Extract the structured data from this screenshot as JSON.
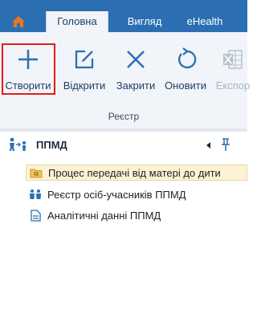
{
  "tabs": {
    "home_icon": "home-icon",
    "items": [
      {
        "label": "Головна",
        "active": true
      },
      {
        "label": "Вигляд",
        "active": false
      },
      {
        "label": "eHealth",
        "active": false
      }
    ]
  },
  "ribbon": {
    "buttons": [
      {
        "label": "Створити",
        "icon": "plus-icon"
      },
      {
        "label": "Відкрити",
        "icon": "edit-icon"
      },
      {
        "label": "Закрити",
        "icon": "close-icon"
      },
      {
        "label": "Оновити",
        "icon": "refresh-icon"
      },
      {
        "label": "Експор",
        "icon": "excel-icon",
        "disabled": true
      }
    ],
    "group_label": "Реєстр",
    "accent_color": "#2b6fb2",
    "highlight_color": "#e41c1c"
  },
  "panel": {
    "title": "ППМД",
    "items": [
      {
        "label": "Процес передачі від матері до дити",
        "icon": "folder-icon",
        "selected": true
      },
      {
        "label": "Реєстр осіб-учасників ППМД",
        "icon": "people-icon"
      },
      {
        "label": "Аналітичні данні ППМД",
        "icon": "document-icon"
      }
    ]
  }
}
